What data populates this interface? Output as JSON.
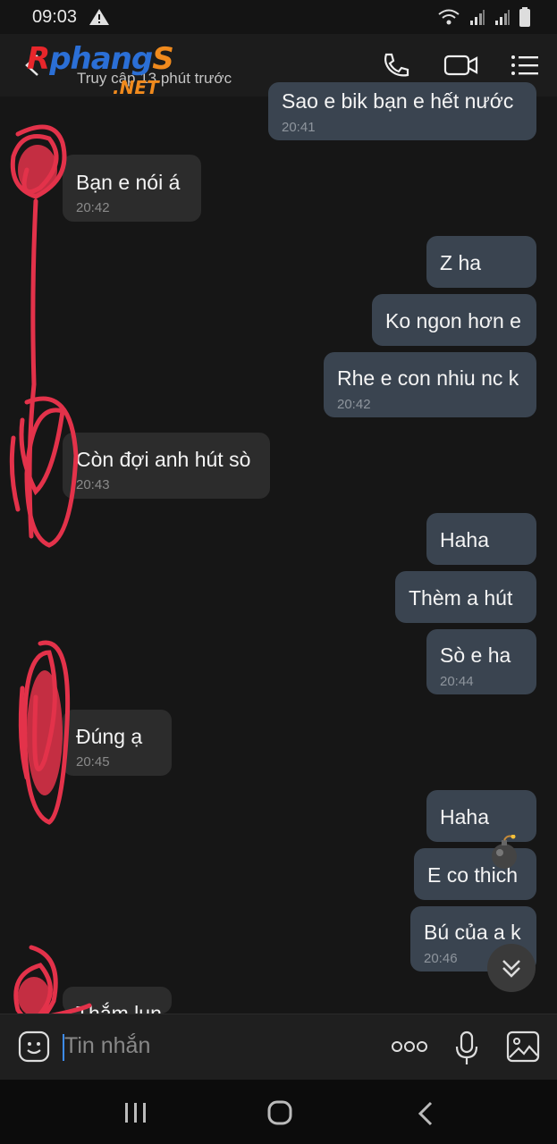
{
  "status_bar": {
    "time": "09:03"
  },
  "header": {
    "subtitle": "Truy cập 13 phút trước",
    "watermark_parts": [
      "R",
      "phang",
      "S"
    ],
    "watermark_net": ".NET",
    "icons": [
      "back-arrow-icon",
      "phone-icon",
      "video-call-icon",
      "menu-icon"
    ]
  },
  "messages": [
    {
      "dir": "out",
      "text": "Sao e bik bạn e hết nước",
      "time": "20:41"
    },
    {
      "dir": "in",
      "text": "Bạn e nói á",
      "time": "20:42"
    },
    {
      "dir": "out",
      "text": "Z ha",
      "time": ""
    },
    {
      "dir": "out",
      "text": "Ko ngon hơn e",
      "time": ""
    },
    {
      "dir": "out",
      "text": "Rhe e con nhiu nc k",
      "time": "20:42"
    },
    {
      "dir": "in",
      "text": "Còn đợi anh hút sò",
      "time": "20:43"
    },
    {
      "dir": "out",
      "text": "Haha",
      "time": ""
    },
    {
      "dir": "out",
      "text": "Thèm a hút",
      "time": ""
    },
    {
      "dir": "out",
      "text": "Sò e ha",
      "time": "20:44"
    },
    {
      "dir": "in",
      "text": "Đúng ạ",
      "time": "20:45"
    },
    {
      "dir": "out",
      "text": "Haha",
      "time": ""
    },
    {
      "dir": "out",
      "text": "E co thich",
      "time": ""
    },
    {
      "dir": "out",
      "text": "Bú của a k",
      "time": "20:46"
    },
    {
      "dir": "in",
      "text": "Thắm lun",
      "time": ""
    }
  ],
  "composer": {
    "placeholder": "Tin nhắn"
  },
  "colors": {
    "outgoing_bubble": "#3a4450",
    "incoming_bubble": "#2c2c2c",
    "scribble": "#e3324a",
    "cursor": "#3d8cf0"
  }
}
